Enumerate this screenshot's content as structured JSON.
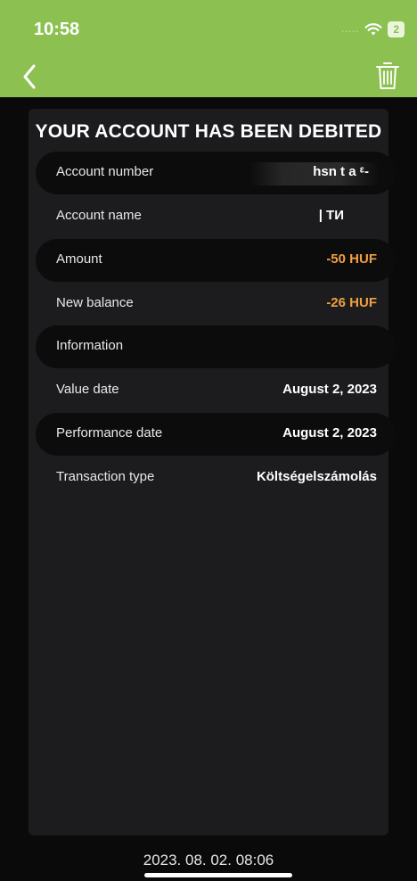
{
  "status": {
    "time": "10:58",
    "signal": ".....",
    "battery": "2"
  },
  "title": "YOUR ACCOUNT HAS BEEN DEBITED",
  "rows": [
    {
      "label": "Account number",
      "value": "hsn t  a   ᵋ-",
      "style": "masked"
    },
    {
      "label": "Account name",
      "value": "| TИ",
      "style": "masked"
    },
    {
      "label": "Amount",
      "value": "-50 HUF",
      "style": "orange"
    },
    {
      "label": "New balance",
      "value": "-26 HUF",
      "style": "orange"
    },
    {
      "label": "Information",
      "value": "",
      "style": "normal"
    },
    {
      "label": "Value date",
      "value": "August 2, 2023",
      "style": "normal"
    },
    {
      "label": "Performance date",
      "value": "August 2, 2023",
      "style": "normal"
    },
    {
      "label": "Transaction type",
      "value": "Költségelszámolás",
      "style": "normal"
    }
  ],
  "footer": {
    "timestamp": "2023. 08. 02. 08:06"
  },
  "colors": {
    "header": "#8cc152",
    "accent": "#f0a040",
    "card": "#1c1c1e",
    "row_shade": "#0c0c0c"
  }
}
